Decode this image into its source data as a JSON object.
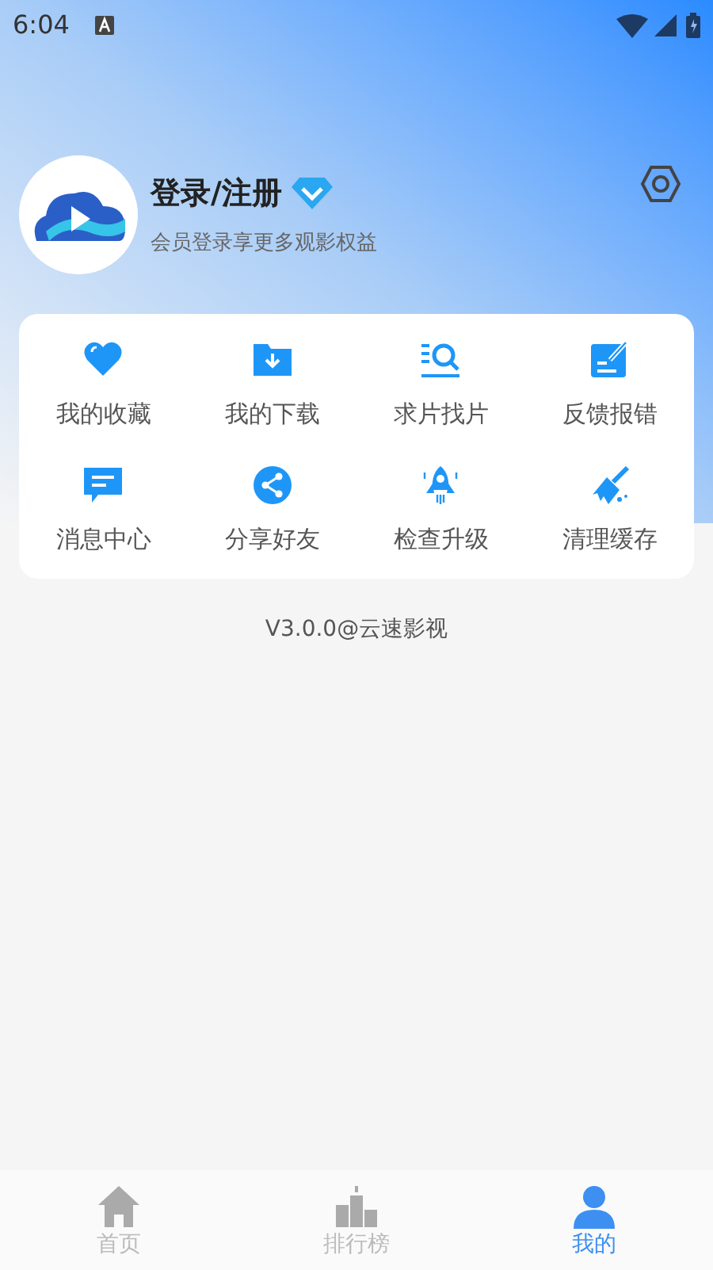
{
  "status_bar": {
    "time": "6:04"
  },
  "profile": {
    "title": "登录/注册",
    "subtitle": "会员登录享更多观影权益"
  },
  "features": [
    {
      "kind": "heart",
      "label": "我的收藏"
    },
    {
      "kind": "download",
      "label": "我的下载"
    },
    {
      "kind": "search",
      "label": "求片找片"
    },
    {
      "kind": "feedback",
      "label": "反馈报错"
    },
    {
      "kind": "message",
      "label": "消息中心"
    },
    {
      "kind": "share",
      "label": "分享好友"
    },
    {
      "kind": "rocket",
      "label": "检查升级"
    },
    {
      "kind": "broom",
      "label": "清理缓存"
    }
  ],
  "version": "V3.0.0@云速影视",
  "tabs": [
    {
      "kind": "home",
      "label": "首页",
      "selected": false
    },
    {
      "kind": "rank",
      "label": "排行榜",
      "selected": false
    },
    {
      "kind": "user",
      "label": "我的",
      "selected": true
    }
  ]
}
